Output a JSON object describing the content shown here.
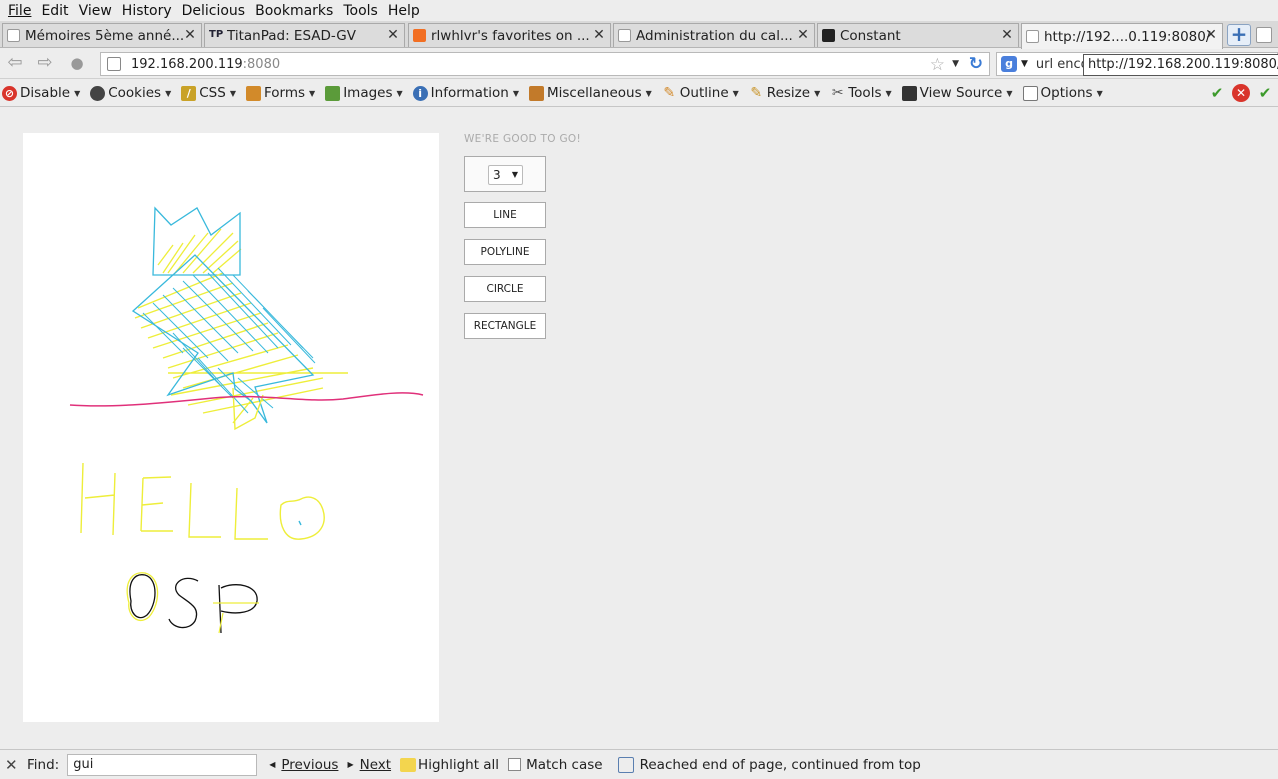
{
  "menubar": {
    "items": [
      "File",
      "Edit",
      "View",
      "History",
      "Delicious",
      "Bookmarks",
      "Tools",
      "Help"
    ]
  },
  "tabs": [
    {
      "label": "Mémoires 5ème anné...",
      "icon": "page-icon"
    },
    {
      "label": "TitanPad: ESAD-GV",
      "icon": "titanpad-icon",
      "icon_text": "TP"
    },
    {
      "label": "rlwhlvr's favorites on ...",
      "icon": "soundcloud-icon"
    },
    {
      "label": "Administration du cal...",
      "icon": "page-icon"
    },
    {
      "label": "Constant",
      "icon": "constant-icon"
    },
    {
      "label": "http://192....0.119:8080/",
      "icon": "page-icon",
      "active": true
    }
  ],
  "navbar": {
    "url_host": "192.168.200.119",
    "url_port": ":8080",
    "search_value": "url enco",
    "tooltip": "http://192.168.200.119:8080/"
  },
  "devbar": {
    "items": [
      {
        "label": "Disable",
        "icon": "disable-icon",
        "color": "#d9342b"
      },
      {
        "label": "Cookies",
        "icon": "cookies-icon",
        "color": "#444444"
      },
      {
        "label": "CSS",
        "icon": "css-icon",
        "color": "#c9a227"
      },
      {
        "label": "Forms",
        "icon": "forms-icon",
        "color": "#d28a2a"
      },
      {
        "label": "Images",
        "icon": "images-icon",
        "color": "#5b9b3a"
      },
      {
        "label": "Information",
        "icon": "information-icon",
        "color": "#3a6fb5"
      },
      {
        "label": "Miscellaneous",
        "icon": "miscellaneous-icon",
        "color": "#c27a2a"
      },
      {
        "label": "Outline",
        "icon": "outline-icon",
        "color": "#d2892a"
      },
      {
        "label": "Resize",
        "icon": "resize-icon",
        "color": "#c9952a"
      },
      {
        "label": "Tools",
        "icon": "tools-icon",
        "color": "#555555"
      },
      {
        "label": "View Source",
        "icon": "view-source-icon",
        "color": "#333333"
      },
      {
        "label": "Options",
        "icon": "options-icon",
        "color": "#777777"
      }
    ]
  },
  "app": {
    "status": "WE'RE GOOD TO GO!",
    "size_value": "3",
    "tools": [
      "LINE",
      "POLYLINE",
      "CIRCLE",
      "RECTANGLE"
    ]
  },
  "findbar": {
    "label": "Find:",
    "value": "gui",
    "previous": "Previous",
    "next": "Next",
    "highlight_all": "Highlight all",
    "match_case": "Match case",
    "status": "Reached end of page, continued from top"
  },
  "colors": {
    "cyan": "#39b9dc",
    "yellow": "#eeee3a",
    "pink": "#e0307a",
    "black": "#111111"
  }
}
